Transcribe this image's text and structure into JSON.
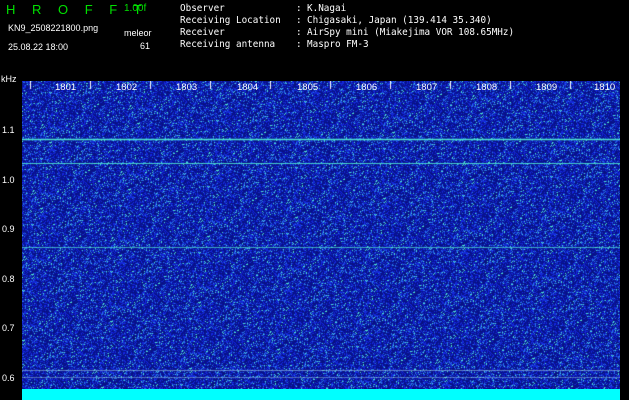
{
  "header": {
    "brand": "H R O F F T",
    "version": "1.00f",
    "filename": "KN9_2508221800.png",
    "meleor_label": "meleor",
    "meleor_value": "61",
    "datetime": "25.08.22 18:00",
    "info": [
      {
        "label": "Observer",
        "value": "K.Nagai"
      },
      {
        "label": "Receiving Location",
        "value": "Chigasaki, Japan (139.414 35.340)"
      },
      {
        "label": "Receiver",
        "value": "AirSpy mini (Miakejima VOR 108.65MHz)"
      },
      {
        "label": "Receiving antenna",
        "value": "Maspro FM-3"
      }
    ]
  },
  "axis": {
    "y_unit": "kHz",
    "y_ticks": [
      "1.1",
      "1.0",
      "0.9",
      "0.8",
      "0.7",
      "0.6"
    ],
    "x_ticks": [
      "1801",
      "1802",
      "1803",
      "1804",
      "1805",
      "1806",
      "1807",
      "1808",
      "1809",
      "1810"
    ]
  },
  "colors": {
    "background": "#000000",
    "noise": "#0a1aa0",
    "signal": "#40e0d0",
    "brand": "#00e000"
  }
}
